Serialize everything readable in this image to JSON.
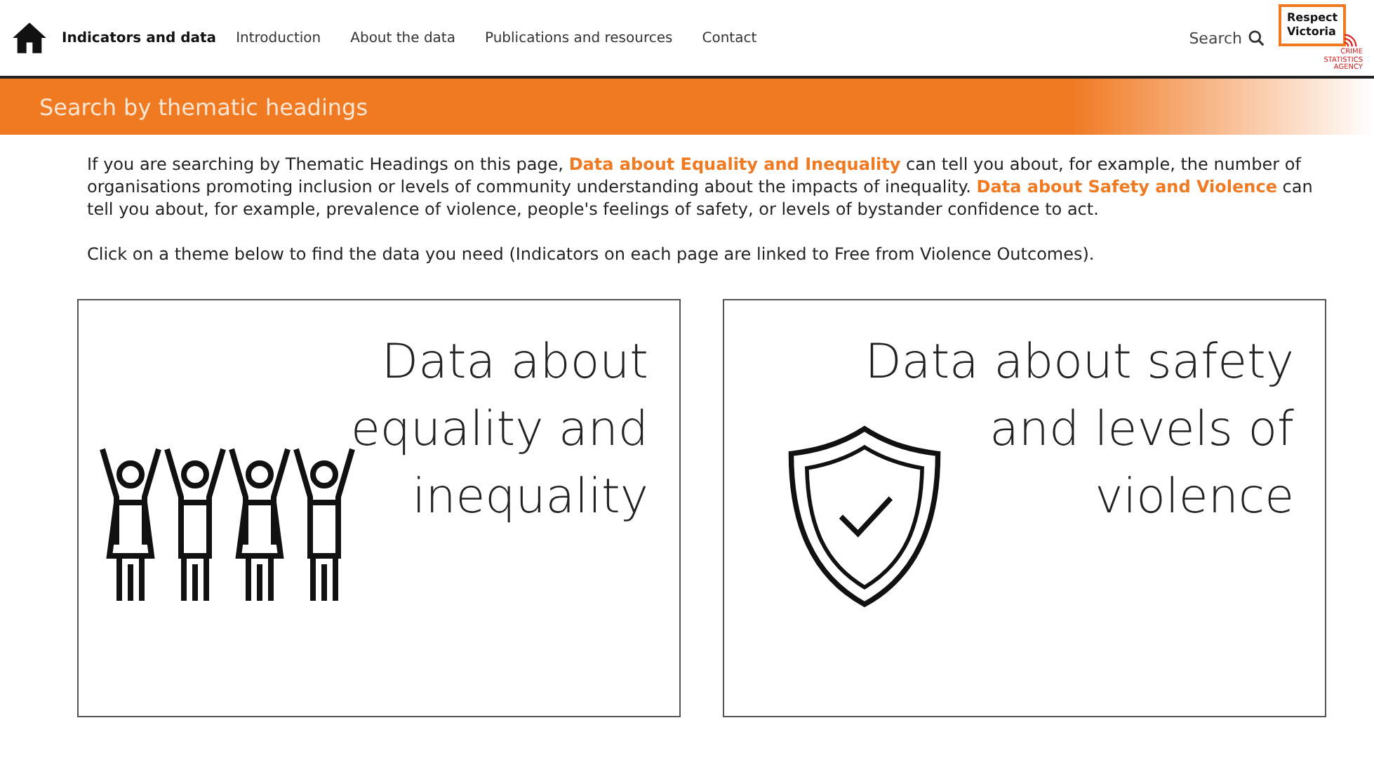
{
  "nav": {
    "items": [
      {
        "label": "Indicators and data",
        "selected": true
      },
      {
        "label": "Introduction",
        "selected": false
      },
      {
        "label": "About the data",
        "selected": false
      },
      {
        "label": "Publications and resources",
        "selected": false
      },
      {
        "label": "Contact",
        "selected": false
      }
    ],
    "search": "Search",
    "logo": {
      "name": "Respect Victoria",
      "agency": "CRIME STATISTICS AGENCY"
    }
  },
  "banner": {
    "title": "Search by thematic headings"
  },
  "intro": [
    {
      "kind": "text",
      "text": "If you are searching by Thematic Headings on this page, "
    },
    {
      "kind": "link",
      "text": "Data about Equality and Inequality"
    },
    {
      "kind": "text",
      "text": " can tell you about, for example, the number of organisations promoting inclusion or levels of community understanding about the impacts of inequality. "
    },
    {
      "kind": "link",
      "text": "Data about Safety and Violence"
    },
    {
      "kind": "text",
      "text": " can tell you about, for example, prevalence of violence, people's feelings of safety, or levels of bystander confidence to act."
    }
  ],
  "instruction": "Click on a theme below to find the data you need (Indicators on each page are linked to Free from Violence Outcomes).",
  "themes": [
    {
      "kind": "people",
      "lines": [
        "Data about",
        "equality and",
        "inequality"
      ]
    },
    {
      "kind": "shield",
      "lines": [
        "Data about safety",
        "and levels of",
        "violence"
      ]
    }
  ]
}
